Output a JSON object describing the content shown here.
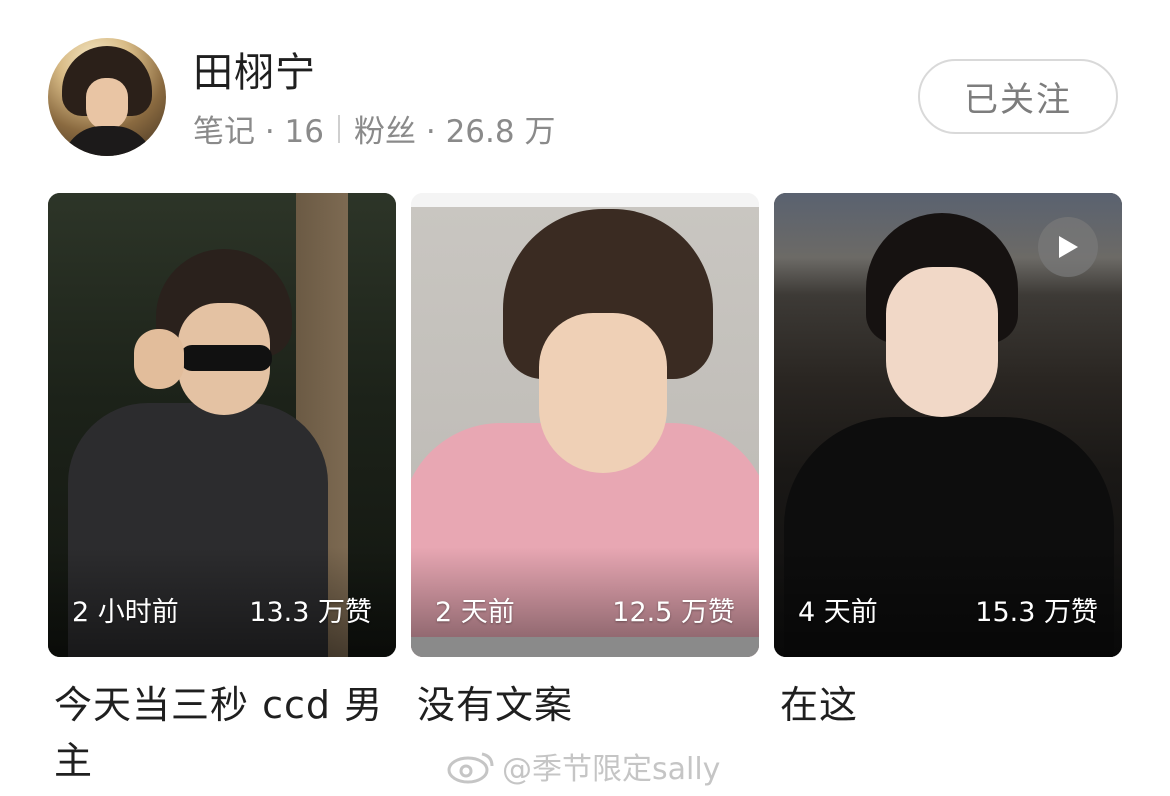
{
  "profile": {
    "name": "田栩宁",
    "notes_label": "笔记 · 16",
    "fans_label": "粉丝 · 26.8 万",
    "follow_button": "已关注"
  },
  "posts": [
    {
      "time": "2 小时前",
      "likes": "13.3 万赞",
      "title": "今天当三秒 ccd 男主",
      "is_video": false
    },
    {
      "time": "2 天前",
      "likes": "12.5 万赞",
      "title": "没有文案",
      "is_video": false
    },
    {
      "time": "4 天前",
      "likes": "15.3 万赞",
      "title": "在这",
      "is_video": true
    }
  ],
  "watermark": "@季节限定sally",
  "colors": {
    "text_primary": "#1f1f1f",
    "text_secondary": "#8a8a8a",
    "follow_border": "#d9d9d9",
    "follow_text": "#7d7d7d"
  }
}
